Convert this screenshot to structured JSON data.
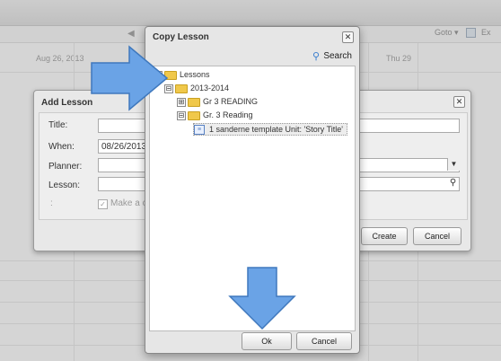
{
  "calendar": {
    "day_headers": [
      "Aug 26, 2013",
      "Thu 29"
    ],
    "goto_label": "Goto ▾",
    "export_label": "Ex"
  },
  "add_lesson": {
    "title": "Add Lesson",
    "fields": [
      {
        "label": "Title:",
        "value": ""
      },
      {
        "label": "When:",
        "value": "08/26/2013"
      },
      {
        "label": "Planner:",
        "value": ""
      },
      {
        "label": "Lesson:",
        "value": ""
      }
    ],
    "colon_label": ":",
    "make_copy_label": "Make a c",
    "create_button": "Create",
    "cancel_button": "Cancel"
  },
  "copy_lesson": {
    "title": "Copy Lesson",
    "search_label": "Search",
    "tree": [
      {
        "label": "Lessons",
        "toggle": "⊟"
      },
      {
        "label": "2013-2014",
        "toggle": "⊟"
      },
      {
        "label": "Gr 3 READING",
        "toggle": "⊞"
      },
      {
        "label": "Gr. 3 Reading",
        "toggle": "⊟"
      },
      {
        "label": "1 sanderne template Unit: 'Story Title'",
        "selected": true
      }
    ],
    "ok_button": "Ok",
    "cancel_button": "Cancel"
  },
  "colors": {
    "arrow_fill": "#6aa3e6",
    "folder": "#f0c84a"
  },
  "icons": [
    "close-icon",
    "search-icon",
    "folder-icon",
    "lesson-doc-icon",
    "right-arrow-annotation",
    "down-arrow-annotation"
  ]
}
